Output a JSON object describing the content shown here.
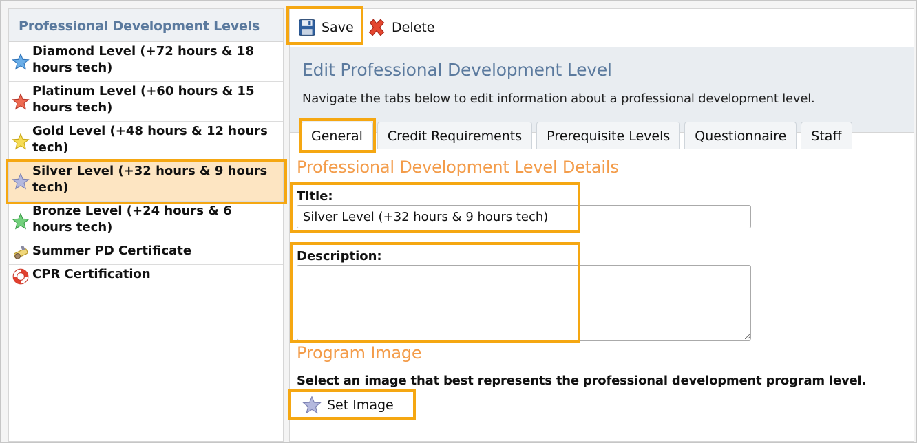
{
  "sidebar": {
    "title": "Professional Development Levels",
    "items": [
      {
        "label_line1": "Diamond Level (+72 hours & 18",
        "label_line2": "hours tech)",
        "icon": "star-blue-icon",
        "color": "#4a90d9"
      },
      {
        "label_line1": "Platinum Level (+60 hours & 15",
        "label_line2": "hours tech)",
        "icon": "star-red-icon",
        "color": "#e8543e"
      },
      {
        "label_line1": "Gold Level (+48 hours & 12 hours",
        "label_line2": "tech)",
        "icon": "star-gold-icon",
        "color": "#f3d33b"
      },
      {
        "label_line1": "Silver Level (+32 hours & 9 hours",
        "label_line2": "tech)",
        "icon": "star-silver-icon",
        "color": "#a9aed6",
        "selected": true
      },
      {
        "label_line1": "Bronze Level (+24 hours & 6",
        "label_line2": "hours tech)",
        "icon": "star-green-icon",
        "color": "#5cc46a"
      },
      {
        "label_line1": "Summer PD Certificate",
        "icon": "certificate-icon"
      },
      {
        "label_line1": "CPR Certification",
        "icon": "lifebuoy-icon"
      }
    ]
  },
  "toolbar": {
    "save_label": "Save",
    "delete_label": "Delete"
  },
  "header": {
    "title": "Edit Professional Development Level",
    "description": "Navigate the tabs below to edit information about a professional development level."
  },
  "tabs": [
    {
      "label": "General",
      "active": true
    },
    {
      "label": "Credit Requirements"
    },
    {
      "label": "Prerequisite Levels"
    },
    {
      "label": "Questionnaire"
    },
    {
      "label": "Staff"
    }
  ],
  "details": {
    "section_title": "Professional Development Level Details",
    "title_label": "Title:",
    "title_value": "Silver Level (+32 hours & 9 hours tech)",
    "description_label": "Description:",
    "description_value": ""
  },
  "program_image": {
    "section_title": "Program Image",
    "instruction": "Select an image that best represents the professional development program level.",
    "set_image_label": "Set Image"
  },
  "colors": {
    "accent_orange": "#f5a712",
    "section_orange": "#f39c4a",
    "title_blue": "#5b7a9e",
    "selected_row": "#fde5c2"
  }
}
